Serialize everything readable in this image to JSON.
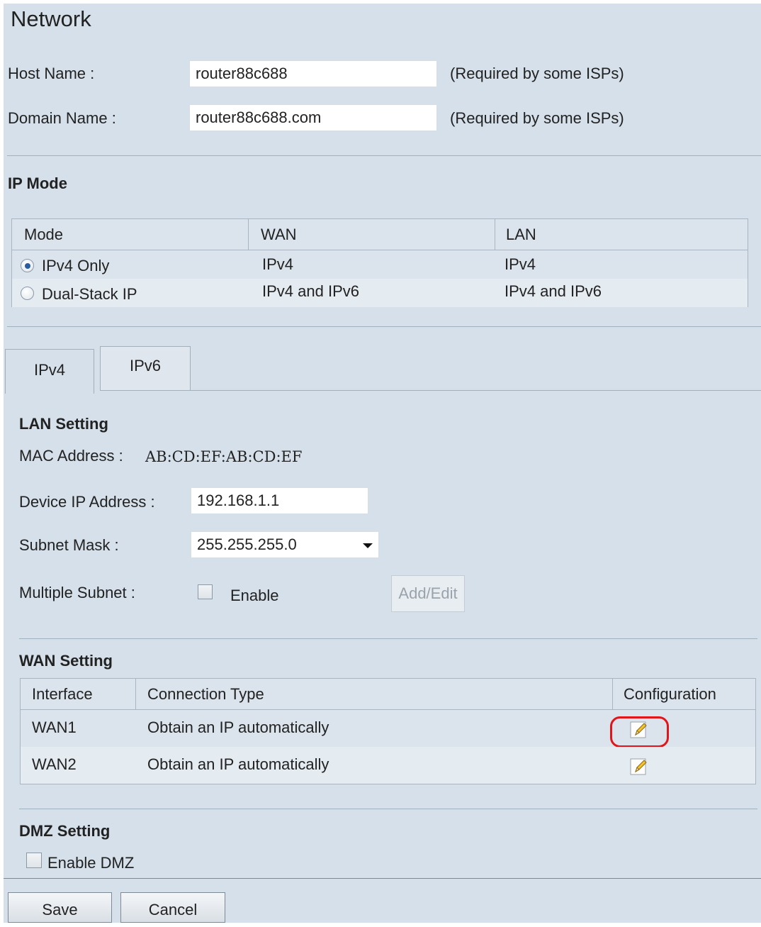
{
  "page": {
    "title": "Network"
  },
  "host": {
    "label": "Host Name :",
    "value": "router88c688",
    "hint": "(Required by some ISPs)"
  },
  "domain": {
    "label": "Domain Name :",
    "value": "router88c688.com",
    "hint": "(Required by some ISPs)"
  },
  "ip_mode": {
    "title": "IP Mode",
    "headers": [
      "Mode",
      "WAN",
      "LAN"
    ],
    "rows": [
      {
        "mode": "IPv4 Only",
        "wan": "IPv4",
        "lan": "IPv4",
        "selected": true
      },
      {
        "mode": "Dual-Stack IP",
        "wan": "IPv4 and IPv6",
        "lan": "IPv4 and IPv6",
        "selected": false
      }
    ]
  },
  "tabs": [
    {
      "label": "IPv4",
      "active": true
    },
    {
      "label": "IPv6",
      "active": false
    }
  ],
  "lan": {
    "title": "LAN Setting",
    "mac_label": "MAC Address :",
    "mac_value": "AB:CD:EF:AB:CD:EF",
    "ip_label": "Device IP Address :",
    "ip_value": "192.168.1.1",
    "mask_label": "Subnet Mask :",
    "mask_value": "255.255.255.0",
    "multi_label": "Multiple Subnet  :",
    "enable_label": "Enable",
    "add_edit_label": "Add/Edit"
  },
  "wan": {
    "title": "WAN Setting",
    "headers": [
      "Interface",
      "Connection Type",
      "Configuration"
    ],
    "rows": [
      {
        "interface": "WAN1",
        "type": "Obtain an IP automatically",
        "config_icon": "edit-icon",
        "highlighted": true
      },
      {
        "interface": "WAN2",
        "type": "Obtain an IP automatically",
        "config_icon": "edit-icon",
        "highlighted": false
      }
    ]
  },
  "dmz": {
    "title": "DMZ Setting",
    "enable_label": "Enable DMZ"
  },
  "buttons": {
    "save": "Save",
    "cancel": "Cancel"
  },
  "colors": {
    "panel_bg": "#d5e0ea",
    "highlight_ring": "#e0161b",
    "radio_selected": "#2a5da0"
  }
}
